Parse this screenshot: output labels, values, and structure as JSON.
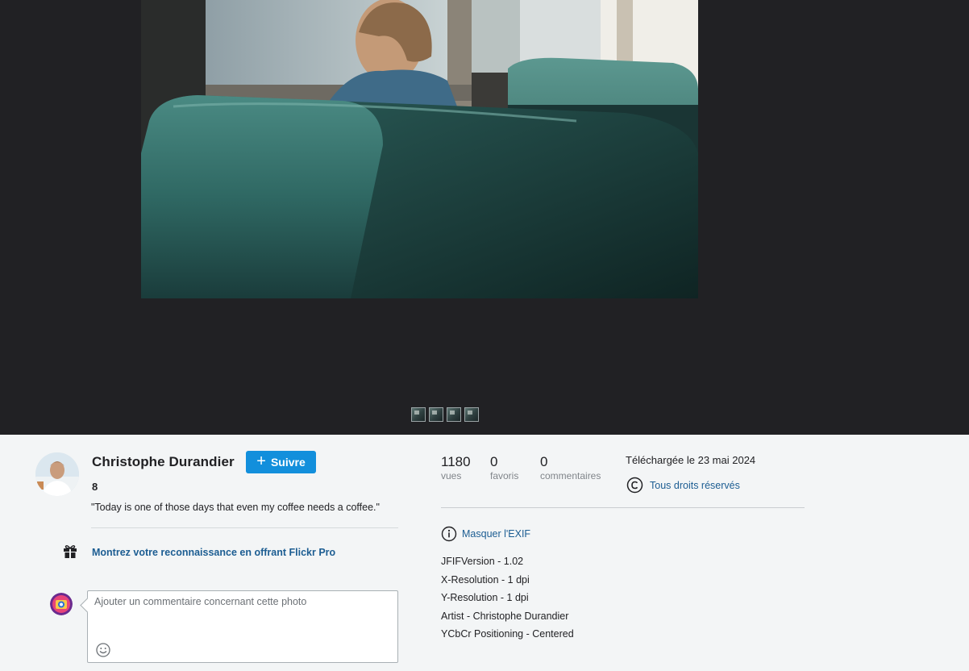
{
  "photo": {
    "thumbnail_count": 4
  },
  "owner": {
    "name": "Christophe Durandier",
    "follow_label": "Suivre",
    "count": "8",
    "title": "\"Today is one of those days that even my coffee needs a coffee.\""
  },
  "gift": {
    "label": "Montrez votre reconnaissance en offrant Flickr Pro"
  },
  "comment": {
    "placeholder": "Ajouter un commentaire concernant cette photo"
  },
  "stats": {
    "views": {
      "value": "1180",
      "label": "vues"
    },
    "faves": {
      "value": "0",
      "label": "favoris"
    },
    "comments": {
      "value": "0",
      "label": "commentaires"
    }
  },
  "meta": {
    "uploaded": "Téléchargée le 23 mai 2024",
    "license": "Tous droits réservés"
  },
  "exif": {
    "toggle_label": "Masquer l'EXIF",
    "items": [
      "JFIFVersion - 1.02",
      "X-Resolution - 1 dpi",
      "Y-Resolution - 1 dpi",
      "Artist - Christophe Durandier",
      "YCbCr Positioning - Centered"
    ]
  },
  "colors": {
    "stage_bg": "#212124",
    "page_bg": "#f3f5f6",
    "follow_button": "#128fdc",
    "link": "#1c5d92"
  },
  "icons": {
    "follow": "plus-icon",
    "gift": "gift-icon",
    "emoji": "smiley-icon",
    "license": "copyright-icon",
    "exif": "info-icon"
  }
}
